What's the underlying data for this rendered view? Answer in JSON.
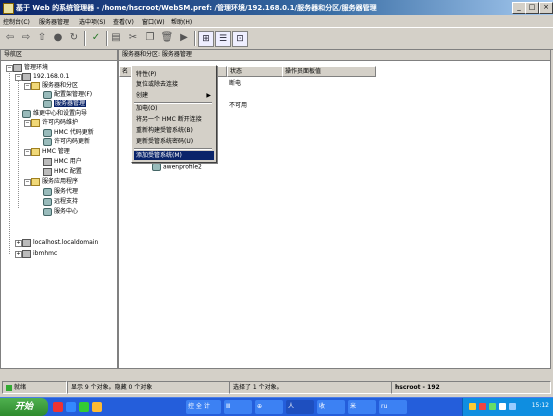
{
  "window": {
    "title": "基于 Web 的系统管理器 - /home/hscroot/WebSM.pref: /管理环境/192.168.0.1/服务器和分区/服务器管理",
    "minimize": "_",
    "maximize": "□",
    "close": "×"
  },
  "menubar": {
    "items": [
      "控制台(C)",
      "服务器管理",
      "选中项(S)",
      "查看(V)",
      "窗口(W)",
      "帮助(H)"
    ]
  },
  "toolbar": {
    "icons": [
      "back-arrow-icon",
      "forward-arrow-icon",
      "up-icon",
      "stop-icon",
      "refresh-icon",
      "check-icon",
      "properties-icon",
      "cut-icon",
      "copy-icon",
      "delete-icon",
      "run-icon",
      "tree-view-icon",
      "details-view-icon",
      "icons-view-icon"
    ]
  },
  "nav": {
    "header": "导航区",
    "tree": [
      {
        "label": "管理环境",
        "expander": "−"
      },
      {
        "label": "192.168.0.1",
        "expander": "−"
      },
      {
        "label": "服务器和分区",
        "expander": "−"
      },
      {
        "label": "配置架管理(F)"
      },
      {
        "label": "服务器管理",
        "selected": true
      },
      {
        "label": "维更中心和设置向导"
      },
      {
        "label": "许可内码维护",
        "expander": "−"
      },
      {
        "label": "HMC 代码更新"
      },
      {
        "label": "许可内码更新"
      },
      {
        "label": "HMC 管理",
        "expander": "−"
      },
      {
        "label": "HMC 用户"
      },
      {
        "label": "HMC 配置"
      },
      {
        "label": "服务应用程序",
        "expander": "−"
      },
      {
        "label": "服务代理"
      },
      {
        "label": "远程支持"
      },
      {
        "label": "服务中心"
      },
      {
        "label": "localhost.localdomain",
        "expander": "+"
      },
      {
        "label": "ibmhmc",
        "expander": "+"
      }
    ]
  },
  "content": {
    "header": "服务器和分区: 服务器管理",
    "columns": [
      "名",
      "状态",
      "操作员面板值"
    ],
    "status_values": [
      "断电",
      "不可用"
    ],
    "profile_item": "awenprofile2"
  },
  "context_menu": {
    "items": [
      {
        "label": "特性(P)"
      },
      {
        "label": "复位或除去连接"
      },
      {
        "label": "创建",
        "submenu": "▶"
      },
      {
        "label": "加电(O)"
      },
      {
        "label": "将另一个 HMC 断开连接"
      },
      {
        "label": "重新构建受管系统(B)"
      },
      {
        "label": "更新受管系统密码(U)"
      },
      {
        "label": "添加受管系统(M)",
        "highlighted": true
      }
    ]
  },
  "statusbar": {
    "ready": "就绪",
    "objects_shown": "显示 9 个对象。隐藏 0 个对象",
    "selected": "选择了 1 个对象。",
    "user_host": "hscroot - 192"
  },
  "taskbar": {
    "start": "开始",
    "tasks": [
      "控 全 计",
      "Ⅲ",
      "⊕",
      "人",
      "收",
      "米",
      "ru"
    ],
    "clock": "15:12"
  }
}
